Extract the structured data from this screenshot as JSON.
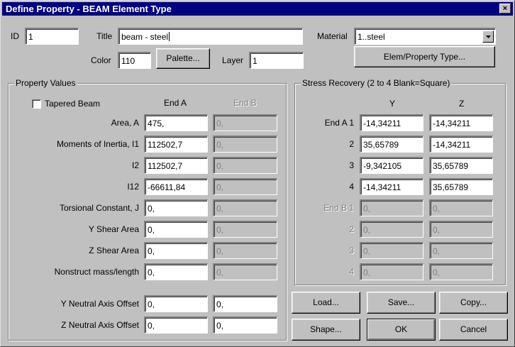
{
  "title": "Define Property - BEAM Element Type",
  "close_glyph": "×",
  "id_label": "ID",
  "id_value": "1",
  "title_label": "Title",
  "title_value": "beam - steel",
  "material_label": "Material",
  "material_value": "1..steel",
  "color_label": "Color",
  "color_value": "110",
  "palette_label": "Palette...",
  "layer_label": "Layer",
  "layer_value": "1",
  "elem_type_label": "Elem/Property Type...",
  "property_values": {
    "title": "Property Values",
    "tapered_label": "Tapered Beam",
    "end_a_header": "End A",
    "end_b_header": "End B",
    "rows": [
      {
        "label": "Area, A",
        "a": "475,",
        "b": "0,"
      },
      {
        "label": "Moments of Inertia, I1",
        "a": "112502,7",
        "b": "0,"
      },
      {
        "label": "I2",
        "a": "112502,7",
        "b": "0,"
      },
      {
        "label": "I12",
        "a": "-66611,84",
        "b": "0,"
      },
      {
        "label": "Torsional Constant, J",
        "a": "0,",
        "b": "0,"
      },
      {
        "label": "Y Shear Area",
        "a": "0,",
        "b": "0,"
      },
      {
        "label": "Z Shear Area",
        "a": "0,",
        "b": "0,"
      },
      {
        "label": "Nonstruct mass/length",
        "a": "0,",
        "b": "0,"
      },
      {
        "label": "Y Neutral Axis Offset",
        "a": "0,",
        "b": "0,"
      },
      {
        "label": "Z Neutral Axis Offset",
        "a": "0,",
        "b": "0,"
      }
    ]
  },
  "stress_recovery": {
    "title": "Stress Recovery (2 to 4 Blank=Square)",
    "y_header": "Y",
    "z_header": "Z",
    "rows": [
      {
        "label": "End A 1",
        "y": "-14,34211",
        "z": "-14,34211"
      },
      {
        "label": "2",
        "y": "35,65789",
        "z": "-14,34211"
      },
      {
        "label": "3",
        "y": "-9,342105",
        "z": "35,65789"
      },
      {
        "label": "4",
        "y": "-14,34211",
        "z": "35,65789"
      },
      {
        "label": "End B 1",
        "y": "0,",
        "z": "0,"
      },
      {
        "label": "2",
        "y": "0,",
        "z": "0,"
      },
      {
        "label": "3",
        "y": "0,",
        "z": "0,"
      },
      {
        "label": "4",
        "y": "0,",
        "z": "0,"
      }
    ]
  },
  "buttons": {
    "load": "Load...",
    "save": "Save...",
    "copy": "Copy...",
    "shape": "Shape...",
    "ok": "OK",
    "cancel": "Cancel"
  }
}
